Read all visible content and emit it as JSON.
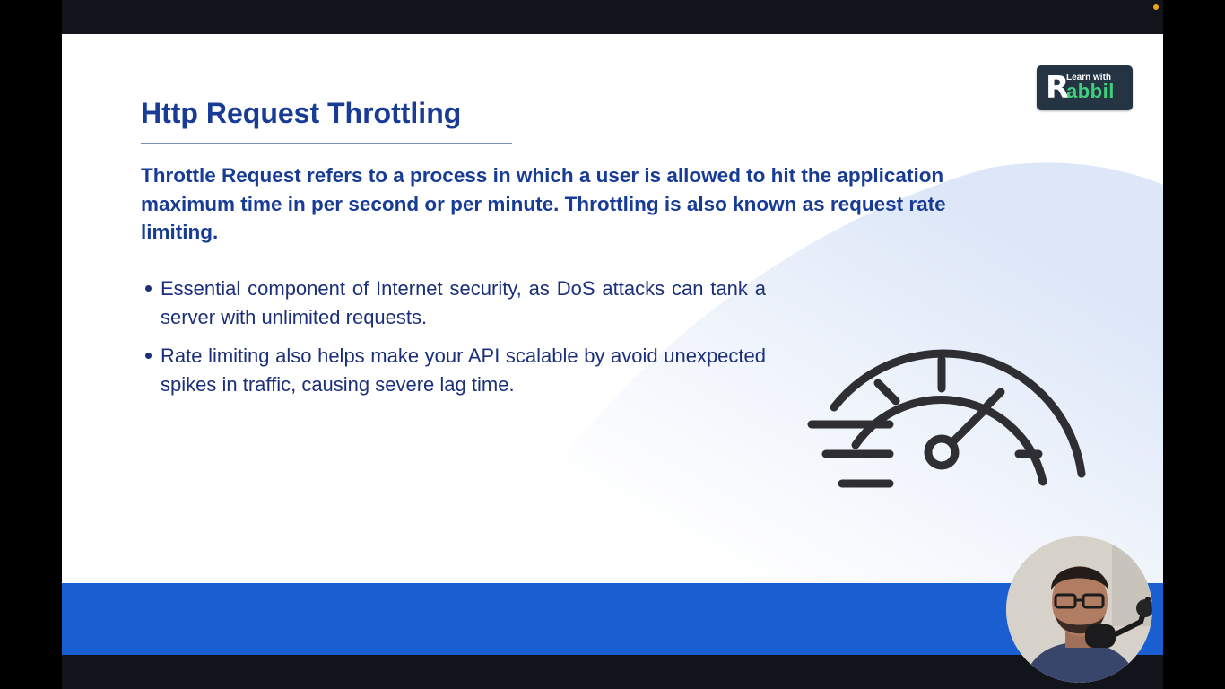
{
  "slide": {
    "title": "Http Request Throttling",
    "intro": "Throttle Request refers to a process in which a user is allowed to hit the application maximum time in per second or per minute.  Throttling is also known as request rate limiting.",
    "bullets": [
      "Essential component of Internet security, as DoS attacks can tank a server with unlimited requests.",
      "Rate limiting also helps make your API scalable by avoid unexpected spikes in traffic, causing severe lag time."
    ],
    "illustration_icon": "speedometer-icon"
  },
  "logo": {
    "letter": "R",
    "line1": "Learn with",
    "line2": "abbil"
  },
  "colors": {
    "title": "#183c96",
    "body_text": "#1b2f7a",
    "accent_band": "#1a5fd1",
    "icon_stroke": "#2f2f33",
    "logo_bg": "#243443",
    "logo_accent": "#3fd07a",
    "frame": "#11151b",
    "recording_dot": "#f0a21a"
  }
}
